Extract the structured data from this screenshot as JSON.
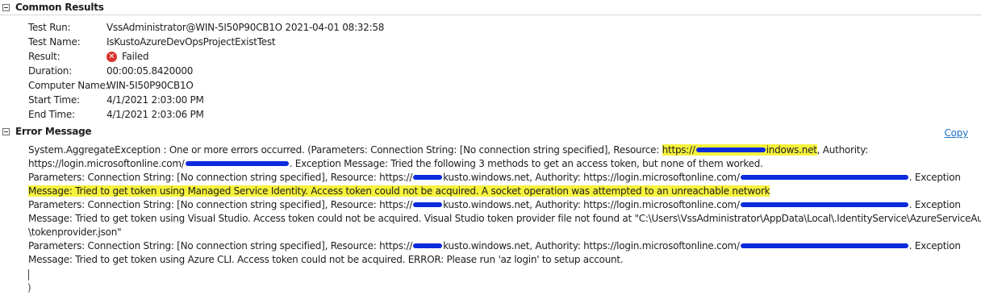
{
  "common_results": {
    "title": "Common Results",
    "fields": [
      {
        "label": "Test Run:",
        "value": "VssAdministrator@WIN-5I50P90CB1O 2021-04-01 08:32:58"
      },
      {
        "label": "Test Name:",
        "value": "IsKustoAzureDevOpsProjectExistTest"
      },
      {
        "label": "Result:",
        "value": "Failed",
        "icon": "failed-x-icon",
        "icon_color": "#d9322b"
      },
      {
        "label": "Duration:",
        "value": "00:00:05.8420000"
      },
      {
        "label": "Computer Name:",
        "value": "WIN-5I50P90CB1O"
      },
      {
        "label": "Start Time:",
        "value": "4/1/2021 2:03:00 PM"
      },
      {
        "label": "End Time:",
        "value": "4/1/2021 2:03:06 PM"
      }
    ]
  },
  "error_message": {
    "title": "Error Message",
    "copy_label": "Copy",
    "highlight_color": "#f6f23d",
    "redaction_color": "#0c2bdc",
    "lines": [
      {
        "a": "System.AggregateException : One or more errors occurred. (Parameters: Connection String: [No connection string specified], Resource: ",
        "b": "https://",
        "c": "indows.net",
        "d": ", Authority:"
      },
      {
        "a": "https://login.microsoftonline.com/",
        "b": ". Exception Message: Tried the following 3 methods to get an access token, but none of them worked."
      },
      {
        "a": "Parameters: Connection String: [No connection string specified], Resource: https://",
        "b": "kusto.windows.net, Authority: https://login.microsoftonline.com/",
        "c": ". Exception"
      },
      {
        "a": "Message: Tried to get token using Managed Service Identity. Access token could not be acquired. A socket operation was attempted to an unreachable network"
      },
      {
        "a": "Parameters: Connection String: [No connection string specified], Resource: https://",
        "b": "kusto.windows.net, Authority: https://login.microsoftonline.com/",
        "c": ". Exception"
      },
      {
        "a": "Message: Tried to get token using Visual Studio. Access token could not be acquired. Visual Studio token provider file not found at \"C:\\Users\\VssAdministrator\\AppData\\Local\\.IdentityService\\AzureServiceAuth"
      },
      {
        "a": "\\tokenprovider.json\""
      },
      {
        "a": "Parameters: Connection String: [No connection string specified], Resource: https://",
        "b": "kusto.windows.net, Authority: https://login.microsoftonline.com/",
        "c": ". Exception"
      },
      {
        "a": "Message: Tried to get token using Azure CLI. Access token could not be acquired. ERROR: Please run 'az login' to setup account."
      }
    ],
    "closing": ")"
  }
}
